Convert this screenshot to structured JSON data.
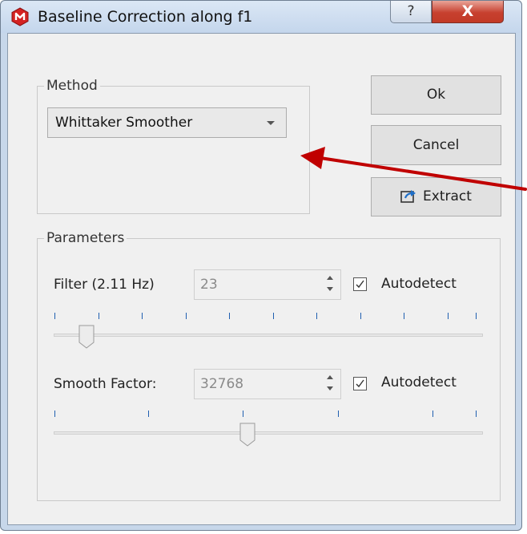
{
  "window": {
    "title": "Baseline Correction along f1",
    "help_label": "?",
    "close_label": "X"
  },
  "method": {
    "legend": "Method",
    "selected": "Whittaker Smoother"
  },
  "buttons": {
    "ok": "Ok",
    "cancel": "Cancel",
    "extract": "Extract"
  },
  "parameters": {
    "legend": "Parameters",
    "filter": {
      "label": "Filter (2.11 Hz)",
      "value": "23",
      "autodetect_label": "Autodetect",
      "autodetect_checked": true,
      "slider_fraction": 0.06
    },
    "smooth": {
      "label": "Smooth Factor:",
      "value": "32768",
      "autodetect_label": "Autodetect",
      "autodetect_checked": true,
      "slider_fraction": 0.45
    }
  },
  "annotation": {
    "arrow_color": "#c00000"
  },
  "colors": {
    "close_button": "#c7402f",
    "slider_ticks": "#1f5fb0"
  },
  "icons": {
    "app": "red-hexagon-app-icon",
    "extract": "export-icon"
  }
}
